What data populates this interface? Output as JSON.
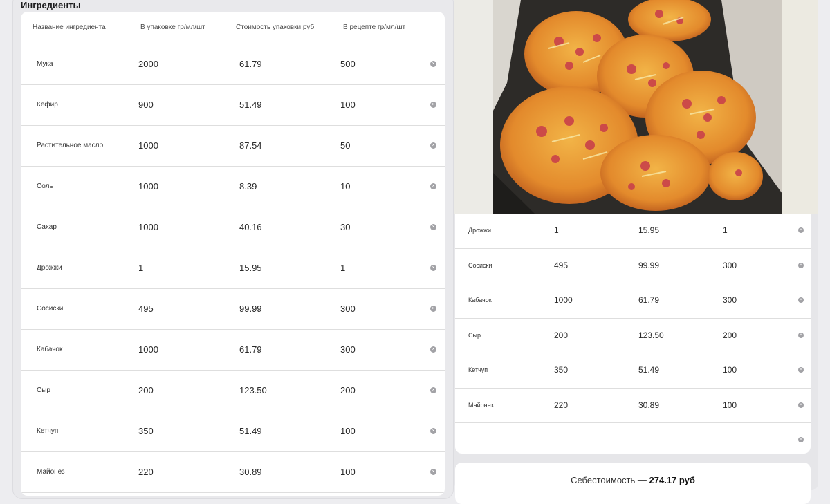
{
  "section": {
    "title": "Ингредиенты"
  },
  "table": {
    "headers": [
      "Название ингредиента",
      "В упаковке гр/мл/шт",
      "Стоимость упаковки руб",
      "В рецепте гр/мл/шт"
    ],
    "rows": [
      {
        "name": "Мука",
        "pack": "2000",
        "cost": "61.79",
        "recipe": "500"
      },
      {
        "name": "Кефир",
        "pack": "900",
        "cost": "51.49",
        "recipe": "100"
      },
      {
        "name": "Растительное масло",
        "pack": "1000",
        "cost": "87.54",
        "recipe": "50"
      },
      {
        "name": "Соль",
        "pack": "1000",
        "cost": "8.39",
        "recipe": "10"
      },
      {
        "name": "Сахар",
        "pack": "1000",
        "cost": "40.16",
        "recipe": "30"
      },
      {
        "name": "Дрожжи",
        "pack": "1",
        "cost": "15.95",
        "recipe": "1"
      },
      {
        "name": "Сосиски",
        "pack": "495",
        "cost": "99.99",
        "recipe": "300"
      },
      {
        "name": "Кабачок",
        "pack": "1000",
        "cost": "61.79",
        "recipe": "300"
      },
      {
        "name": "Сыр",
        "pack": "200",
        "cost": "123.50",
        "recipe": "200"
      },
      {
        "name": "Кетчуп",
        "pack": "350",
        "cost": "51.49",
        "recipe": "100"
      },
      {
        "name": "Майонез",
        "pack": "220",
        "cost": "30.89",
        "recipe": "100"
      }
    ]
  },
  "table2": {
    "rows": [
      {
        "name": "Дрожжи",
        "pack": "1",
        "cost": "15.95",
        "recipe": "1"
      },
      {
        "name": "Сосиски",
        "pack": "495",
        "cost": "99.99",
        "recipe": "300"
      },
      {
        "name": "Кабачок",
        "pack": "1000",
        "cost": "61.79",
        "recipe": "300"
      },
      {
        "name": "Сыр",
        "pack": "200",
        "cost": "123.50",
        "recipe": "200"
      },
      {
        "name": "Кетчуп",
        "pack": "350",
        "cost": "51.49",
        "recipe": "100"
      },
      {
        "name": "Майонез",
        "pack": "220",
        "cost": "30.89",
        "recipe": "100"
      },
      {
        "name": "",
        "pack": "",
        "cost": "",
        "recipe": ""
      }
    ]
  },
  "total": {
    "label": "Себестоимость —",
    "value": "274.17 руб"
  },
  "icons": {
    "delete": "close-circle-icon"
  },
  "colors": {
    "background": "#ededf0",
    "card": "#ffffff",
    "delete_icon": "#a2a2a6"
  }
}
